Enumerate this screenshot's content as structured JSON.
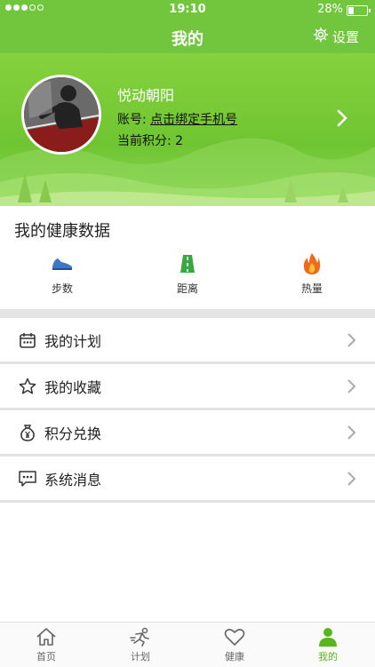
{
  "status_bar": {
    "time": "19:10",
    "battery": "28%",
    "battery_level": 0.28
  },
  "nav": {
    "title": "我的",
    "settings_label": "设置"
  },
  "profile": {
    "name": "悦动朝阳",
    "account_label": "账号:",
    "account_link": "点击绑定手机号",
    "points_label": "当前积分:",
    "points_value": "2"
  },
  "health": {
    "title": "我的健康数据",
    "metrics": [
      {
        "label": "步数",
        "icon": "shoe-icon"
      },
      {
        "label": "距离",
        "icon": "road-icon"
      },
      {
        "label": "热量",
        "icon": "flame-icon"
      }
    ]
  },
  "menu": [
    {
      "label": "我的计划",
      "icon": "calendar-icon"
    },
    {
      "label": "我的收藏",
      "icon": "star-icon"
    },
    {
      "label": "积分兑换",
      "icon": "money-bag-icon"
    },
    {
      "label": "系统消息",
      "icon": "message-icon"
    }
  ],
  "tabs": [
    {
      "label": "首页",
      "icon": "home-icon"
    },
    {
      "label": "计划",
      "icon": "runner-icon"
    },
    {
      "label": "健康",
      "icon": "heart-icon"
    },
    {
      "label": "我的",
      "icon": "person-icon",
      "active": true
    }
  ],
  "colors": {
    "brand": "#72c63e",
    "active_tab": "#57b51e"
  }
}
